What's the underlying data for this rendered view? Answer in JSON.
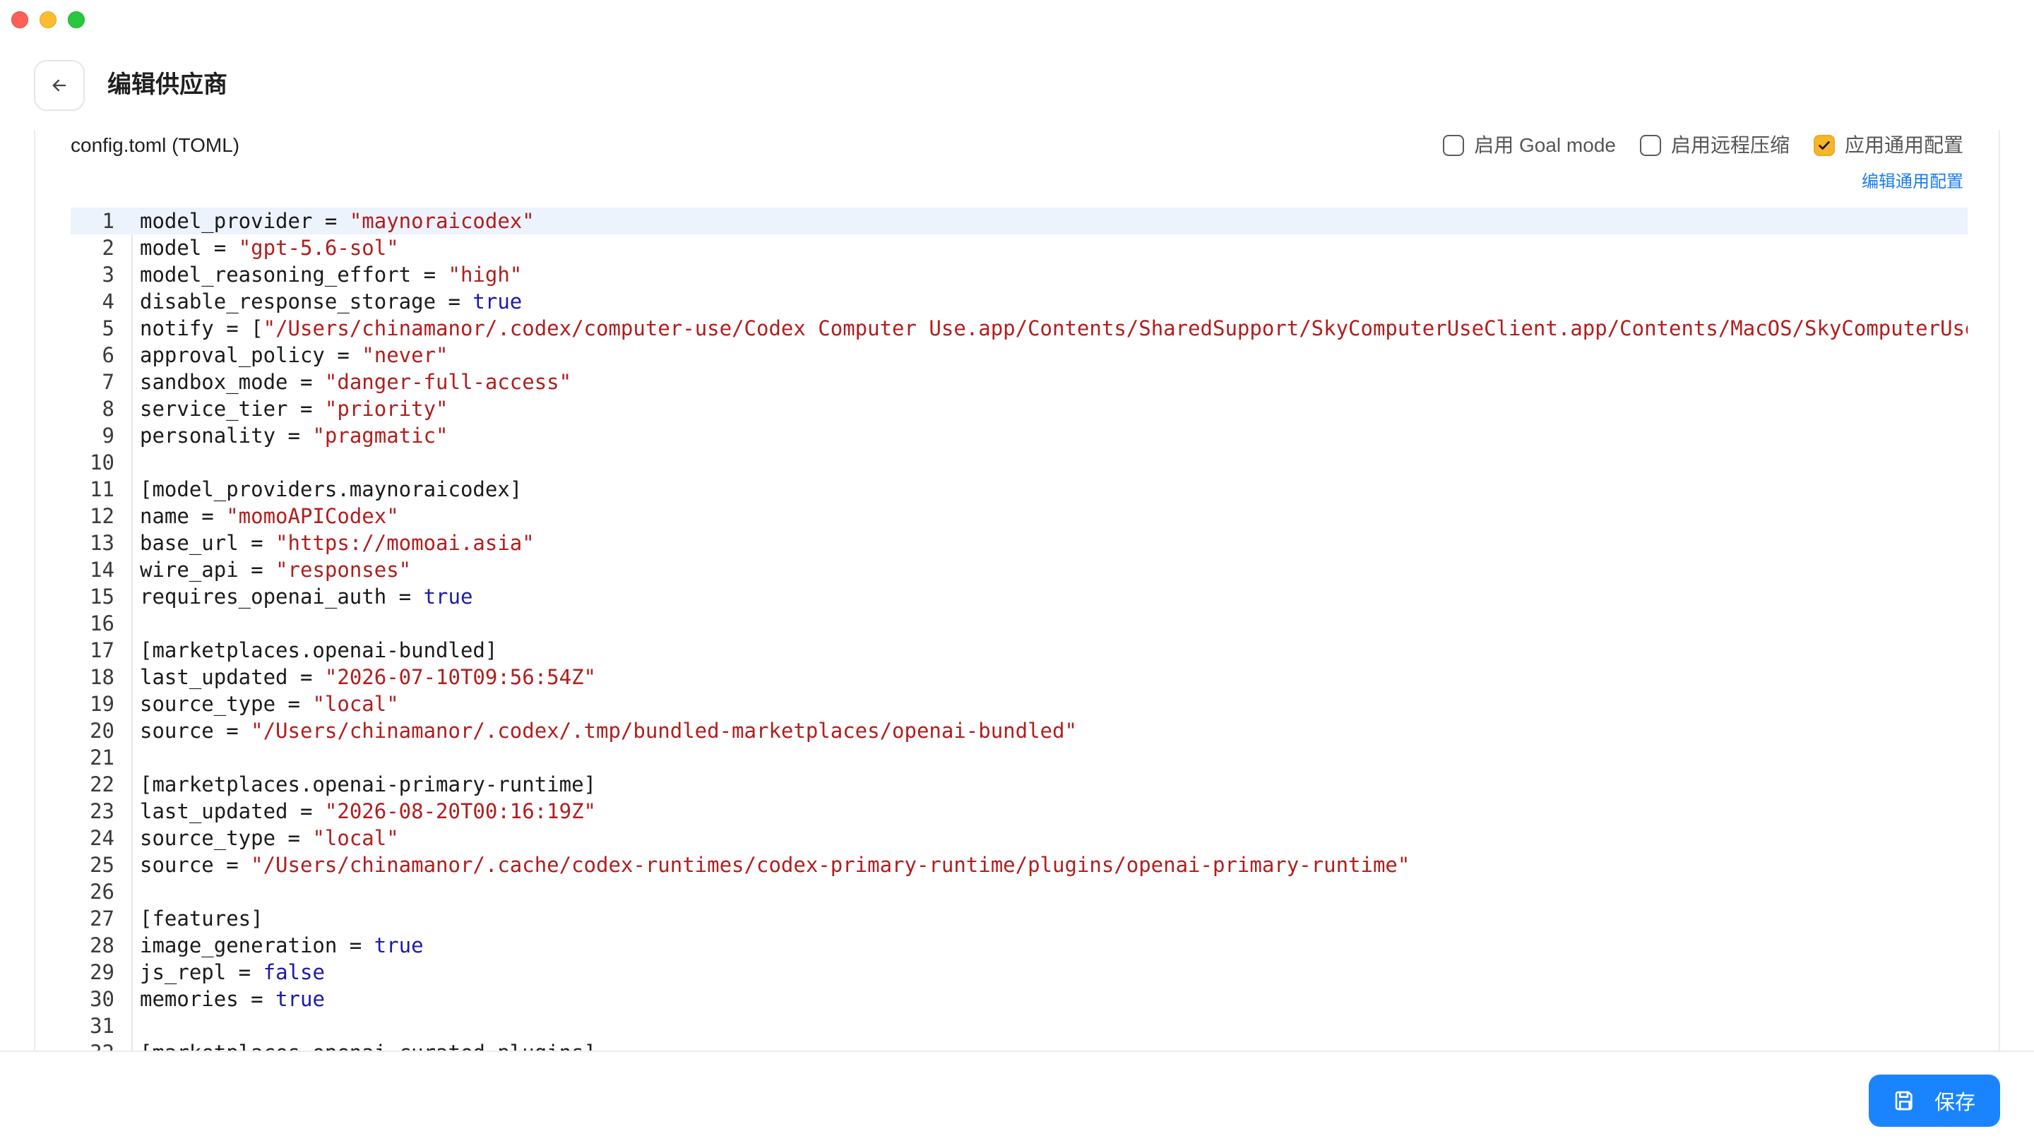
{
  "window": {
    "title": "编辑供应商"
  },
  "header": {
    "title": "编辑供应商",
    "back_icon": "arrow-left-icon"
  },
  "panel": {
    "file_label": "config.toml (TOML)",
    "options": [
      {
        "label": "启用 Goal mode",
        "checked": false
      },
      {
        "label": "启用远程压缩",
        "checked": false
      },
      {
        "label": "应用通用配置",
        "checked": true
      }
    ],
    "edit_common_link": "编辑通用配置"
  },
  "editor": {
    "active_line": 1,
    "lines": [
      [
        [
          "k",
          "model_provider = "
        ],
        [
          "s",
          "\"maynoraicodex\""
        ]
      ],
      [
        [
          "k",
          "model = "
        ],
        [
          "s",
          "\"gpt-5.6-sol\""
        ]
      ],
      [
        [
          "k",
          "model_reasoning_effort = "
        ],
        [
          "s",
          "\"high\""
        ]
      ],
      [
        [
          "k",
          "disable_response_storage = "
        ],
        [
          "b",
          "true"
        ]
      ],
      [
        [
          "k",
          "notify = ["
        ],
        [
          "s",
          "\"/Users/chinamanor/.codex/computer-use/Codex Computer Use.app/Contents/SharedSupport/SkyComputerUseClient.app/Contents/MacOS/SkyComputerUseC"
        ]
      ],
      [
        [
          "k",
          "approval_policy = "
        ],
        [
          "s",
          "\"never\""
        ]
      ],
      [
        [
          "k",
          "sandbox_mode = "
        ],
        [
          "s",
          "\"danger-full-access\""
        ]
      ],
      [
        [
          "k",
          "service_tier = "
        ],
        [
          "s",
          "\"priority\""
        ]
      ],
      [
        [
          "k",
          "personality = "
        ],
        [
          "s",
          "\"pragmatic\""
        ]
      ],
      [],
      [
        [
          "k",
          "[model_providers.maynoraicodex]"
        ]
      ],
      [
        [
          "k",
          "name = "
        ],
        [
          "s",
          "\"momoAPICodex\""
        ]
      ],
      [
        [
          "k",
          "base_url = "
        ],
        [
          "s",
          "\"https://momoai.asia\""
        ]
      ],
      [
        [
          "k",
          "wire_api = "
        ],
        [
          "s",
          "\"responses\""
        ]
      ],
      [
        [
          "k",
          "requires_openai_auth = "
        ],
        [
          "b",
          "true"
        ]
      ],
      [],
      [
        [
          "k",
          "[marketplaces.openai-bundled]"
        ]
      ],
      [
        [
          "k",
          "last_updated = "
        ],
        [
          "s",
          "\"2026-07-10T09:56:54Z\""
        ]
      ],
      [
        [
          "k",
          "source_type = "
        ],
        [
          "s",
          "\"local\""
        ]
      ],
      [
        [
          "k",
          "source = "
        ],
        [
          "s",
          "\"/Users/chinamanor/.codex/.tmp/bundled-marketplaces/openai-bundled\""
        ]
      ],
      [],
      [
        [
          "k",
          "[marketplaces.openai-primary-runtime]"
        ]
      ],
      [
        [
          "k",
          "last_updated = "
        ],
        [
          "s",
          "\"2026-08-20T00:16:19Z\""
        ]
      ],
      [
        [
          "k",
          "source_type = "
        ],
        [
          "s",
          "\"local\""
        ]
      ],
      [
        [
          "k",
          "source = "
        ],
        [
          "s",
          "\"/Users/chinamanor/.cache/codex-runtimes/codex-primary-runtime/plugins/openai-primary-runtime\""
        ]
      ],
      [],
      [
        [
          "k",
          "[features]"
        ]
      ],
      [
        [
          "k",
          "image_generation = "
        ],
        [
          "b",
          "true"
        ]
      ],
      [
        [
          "k",
          "js_repl = "
        ],
        [
          "b",
          "false"
        ]
      ],
      [
        [
          "k",
          "memories = "
        ],
        [
          "b",
          "true"
        ]
      ],
      [],
      [
        [
          "k",
          "[marketplaces.openai-curated-plugins]"
        ]
      ]
    ]
  },
  "footer": {
    "save_label": "保存",
    "save_icon": "floppy-disk-icon"
  },
  "colors": {
    "accent": "#1a84ff",
    "checkbox_checked": "#f7b52c",
    "string": "#b21d1d",
    "boolean": "#1c1aa8"
  }
}
